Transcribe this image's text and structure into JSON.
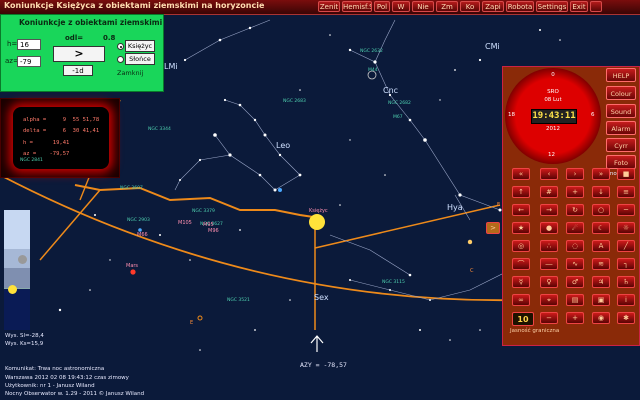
{
  "app": {
    "window_title": "Koniunkcje Księżyca z obiektami ziemskimi na horyzoncie",
    "menu": [
      "Zenit",
      "Hemisf.Sev",
      "Pol",
      "W",
      "Nie",
      "Zm",
      "Ko",
      "Zapi",
      "Robota",
      "Settings",
      "Exit"
    ]
  },
  "dialog": {
    "title": "Koniunkcje z obiektami ziemskimi",
    "odl_label": "odl=",
    "odl_value": "0.8",
    "h_label": "h=",
    "h_value": "16",
    "az_label": "az=",
    "az_value": "-79",
    "go_button": ">",
    "step_button": "-1d",
    "radio_moon": "Księżyc",
    "radio_sun": "Słońce",
    "close_button": "Zamknij"
  },
  "readout": {
    "alpha": "alpha =     9  55 51,78",
    "delta": "delta =     6  30 41,41",
    "h": "h =      19,41",
    "az": "az =    -79,57"
  },
  "sky": {
    "constellations": [
      "LMi",
      "CMi",
      "Cnc",
      "Leo",
      "Hya",
      "Sex"
    ],
    "planet": "Mars",
    "moon_label": "Księżyc",
    "azimuth_label": "AZY = -78,57",
    "ngc": [
      "NGC 2841",
      "NGC 2683",
      "NGC 2632",
      "NGC 2682",
      "NGC 3344",
      "NGC 3607",
      "NGC 3379",
      "NGC 2903",
      "NGC 3115",
      "NGC 3521",
      "NGC 3627",
      "M67",
      "M44",
      "M95",
      "M96",
      "M105",
      "M66"
    ],
    "horizon_letters": [
      "S",
      "E",
      "E",
      "C"
    ]
  },
  "leftpanel": {
    "wys_sl": "Wys. Sl=-28,4",
    "wys_ks": "Wys. Ks=15,9"
  },
  "info": {
    "line1": "Komunikat: Trwa noc astronomiczna",
    "line2": "Warszawa  2012 02 08  19:43:12 czas zimowy",
    "line3": "Użytkownik: nr 1 - Janusz Wiland",
    "line4": "Nocny Obserwator w. 1.29 - 2011 © Janusz Wiland"
  },
  "clock": {
    "day": "SRO",
    "date": "08 Lut",
    "time": "19:43:11",
    "year": "2012",
    "digits": [
      "0",
      "2",
      "4",
      "6",
      "8",
      "10",
      "12",
      "14",
      "16",
      "18",
      "20",
      "22"
    ]
  },
  "rightpanel": {
    "buttons": [
      "HELP",
      "Colour",
      "Sound",
      "Alarm",
      "Cyrr",
      "Foto"
    ],
    "moon_label": "moonfull",
    "limit_value": "10",
    "limit_label": "Jasność graniczna"
  },
  "colors": {
    "sky": "#0b1a3a",
    "horizon": "#ee8a1a",
    "panel_red": "#8a2a08",
    "dialog_green": "#19d65a"
  }
}
